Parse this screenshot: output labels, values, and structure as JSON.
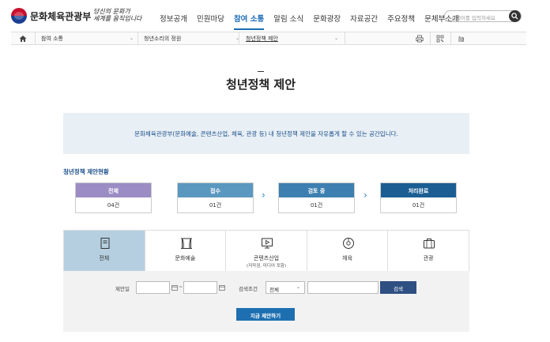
{
  "header": {
    "logo_text": "문화체육관광부",
    "slogan_line1": "당신의 문화가",
    "slogan_line2": "세계를 움직입니다",
    "nav": [
      "정보공개",
      "민원마당",
      "참여 소통",
      "알림 소식",
      "문화광장",
      "자료공간",
      "주요정책",
      "문체부소개"
    ],
    "active_nav_index": 2,
    "search_placeholder": "검색어를 입력하세요"
  },
  "breadcrumb": {
    "level1": "참여 소통",
    "level2": "청년소리의 정원",
    "level3": "청년정책 제안"
  },
  "page": {
    "title": "청년정책 제안",
    "intro": "문화체육관광부(문화예술, 콘텐츠산업, 체육, 관광 등) 내 청년정책 제안을 자유롭게 할 수 있는 공간입니다."
  },
  "status": {
    "heading": "청년정책 제안현황",
    "cards": [
      {
        "label": "전체",
        "count": "04건",
        "color": "#9b8cc4"
      },
      {
        "label": "접수",
        "count": "01건",
        "color": "#5b98c0"
      },
      {
        "label": "검토 중",
        "count": "01건",
        "color": "#3c7fb0"
      },
      {
        "label": "처리완료",
        "count": "01건",
        "color": "#1b5e93"
      }
    ]
  },
  "categories": [
    {
      "label": "전체",
      "sub": "",
      "icon": "document-icon"
    },
    {
      "label": "문화예술",
      "sub": "",
      "icon": "stage-curtain-icon"
    },
    {
      "label": "콘텐츠산업",
      "sub": "(저작권, 미디어 포함)",
      "icon": "monitor-play-icon"
    },
    {
      "label": "체육",
      "sub": "",
      "icon": "ball-icon"
    },
    {
      "label": "관광",
      "sub": "",
      "icon": "suitcase-icon"
    }
  ],
  "filter": {
    "date_label": "제안일",
    "date_separator": "~",
    "condition_label": "검색조건",
    "condition_value": "전체",
    "keyword_value": "",
    "search_button": "검색",
    "propose_button": "지금 제안하기"
  }
}
